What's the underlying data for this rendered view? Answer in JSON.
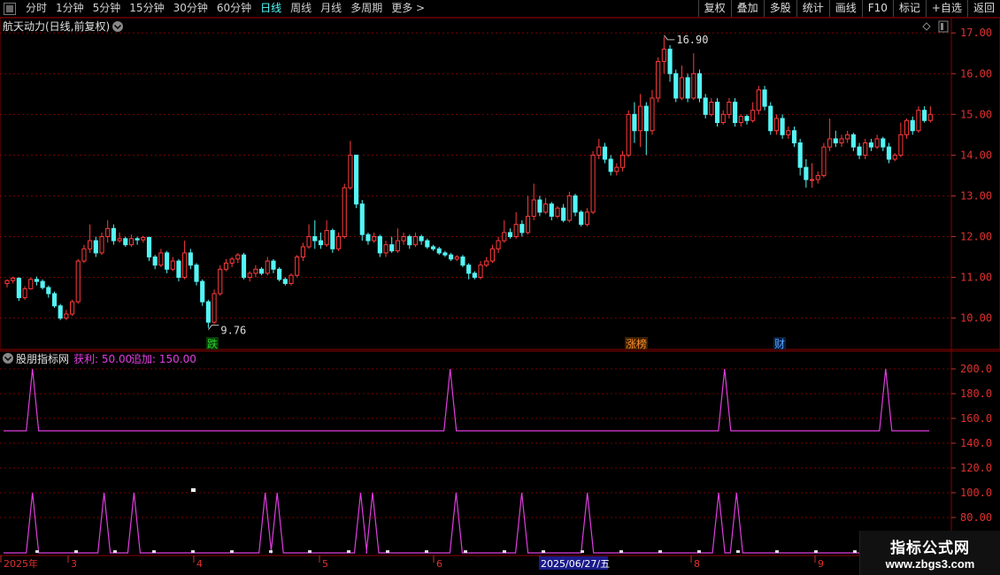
{
  "toolbar": {
    "periods": [
      "分时",
      "1分钟",
      "5分钟",
      "15分钟",
      "30分钟",
      "60分钟",
      "日线",
      "周线",
      "月线",
      "多周期",
      "更多 >"
    ],
    "active_period": "日线",
    "actions": [
      "复权",
      "叠加",
      "多股",
      "统计",
      "画线",
      "F10",
      "标记",
      "+自选",
      "返回"
    ]
  },
  "main_title": "航天动力(日线,前复权)",
  "price_axis": {
    "ticks": [
      "17.00",
      "16.00",
      "15.00",
      "14.00",
      "13.00",
      "12.00",
      "11.00",
      "10.00"
    ]
  },
  "annotations": {
    "high": "16.90",
    "low": "9.76"
  },
  "badges": [
    {
      "text": "跌",
      "color": "#2bd02b"
    },
    {
      "text": "涨榜",
      "color": "#ff8c2a"
    },
    {
      "text": "财",
      "color": "#56a0ff"
    }
  ],
  "indicator": {
    "name": "股朋指标网",
    "value1_label": "获利: 50.00",
    "value2_label": "追加: 150.00",
    "axis_ticks": [
      "200.0",
      "180.0",
      "160.0",
      "140.0",
      "120.0",
      "100.0",
      "80.00"
    ]
  },
  "date_axis": {
    "labels": [
      "2025年",
      "3",
      "4",
      "5",
      "6",
      "2025/06/27/五",
      "8",
      "9"
    ]
  },
  "watermark": {
    "line1": "指标公式网",
    "line2": "www.zbgs3.com"
  },
  "colors": {
    "up": "#ff3b3b",
    "down": "#54f5f5",
    "indicator": "#e03ee0",
    "grid": "#7a0000"
  },
  "chart_data": {
    "type": "candlestick",
    "y_range": [
      9.6,
      17.2
    ],
    "candles": [
      [
        10.85,
        10.92,
        10.75,
        10.95
      ],
      [
        10.92,
        10.98,
        10.85,
        11.02
      ],
      [
        10.98,
        10.5,
        10.42,
        11.0
      ],
      [
        10.5,
        10.72,
        10.45,
        10.78
      ],
      [
        10.72,
        10.95,
        10.7,
        11.0
      ],
      [
        10.95,
        10.9,
        10.8,
        11.02
      ],
      [
        10.9,
        10.75,
        10.7,
        10.95
      ],
      [
        10.75,
        10.6,
        10.5,
        10.8
      ],
      [
        10.6,
        10.3,
        10.25,
        10.65
      ],
      [
        10.3,
        10.0,
        9.95,
        10.35
      ],
      [
        10.0,
        10.1,
        9.95,
        10.2
      ],
      [
        10.1,
        10.4,
        10.05,
        10.45
      ],
      [
        10.4,
        11.4,
        10.35,
        11.45
      ],
      [
        11.4,
        11.7,
        11.35,
        11.8
      ],
      [
        11.7,
        11.9,
        11.6,
        12.3
      ],
      [
        11.9,
        11.6,
        11.5,
        12.0
      ],
      [
        11.6,
        12.0,
        11.55,
        12.1
      ],
      [
        12.0,
        12.2,
        11.85,
        12.4
      ],
      [
        12.2,
        11.9,
        11.8,
        12.3
      ],
      [
        11.9,
        11.95,
        11.85,
        12.1
      ],
      [
        11.95,
        11.8,
        11.75,
        12.0
      ],
      [
        11.8,
        11.95,
        11.75,
        12.05
      ],
      [
        11.95,
        11.92,
        11.8,
        12.0
      ],
      [
        11.92,
        11.98,
        11.85,
        12.02
      ],
      [
        11.98,
        11.5,
        11.4,
        12.0
      ],
      [
        11.5,
        11.3,
        11.2,
        11.55
      ],
      [
        11.3,
        11.6,
        11.25,
        11.7
      ],
      [
        11.6,
        11.2,
        11.1,
        11.65
      ],
      [
        11.2,
        11.4,
        11.15,
        11.5
      ],
      [
        11.4,
        11.0,
        10.9,
        11.45
      ],
      [
        11.0,
        11.6,
        10.95,
        11.9
      ],
      [
        11.6,
        11.3,
        11.2,
        11.7
      ],
      [
        11.3,
        10.9,
        10.8,
        11.35
      ],
      [
        10.9,
        10.4,
        10.3,
        10.95
      ],
      [
        10.4,
        9.9,
        9.76,
        10.45
      ],
      [
        9.9,
        10.6,
        9.85,
        10.7
      ],
      [
        10.6,
        11.2,
        10.55,
        11.3
      ],
      [
        11.2,
        11.35,
        11.15,
        11.45
      ],
      [
        11.35,
        11.45,
        11.25,
        11.5
      ],
      [
        11.45,
        11.55,
        11.35,
        11.6
      ],
      [
        11.55,
        11.0,
        10.95,
        11.6
      ],
      [
        11.0,
        11.1,
        10.9,
        11.15
      ],
      [
        11.1,
        11.2,
        11.0,
        11.3
      ],
      [
        11.2,
        11.1,
        11.05,
        11.25
      ],
      [
        11.1,
        11.4,
        11.05,
        11.5
      ],
      [
        11.4,
        11.2,
        11.1,
        11.45
      ],
      [
        11.2,
        10.95,
        10.9,
        11.25
      ],
      [
        10.95,
        10.85,
        10.8,
        11.0
      ],
      [
        10.85,
        11.05,
        10.8,
        11.1
      ],
      [
        11.05,
        11.5,
        11.0,
        11.55
      ],
      [
        11.5,
        11.75,
        11.4,
        11.85
      ],
      [
        11.75,
        12.0,
        11.7,
        12.3
      ],
      [
        12.0,
        11.9,
        11.7,
        12.4
      ],
      [
        11.9,
        11.8,
        11.7,
        12.1
      ],
      [
        11.8,
        12.15,
        11.75,
        12.4
      ],
      [
        12.15,
        11.7,
        11.6,
        12.2
      ],
      [
        11.7,
        12.0,
        11.65,
        12.1
      ],
      [
        12.0,
        13.2,
        11.95,
        13.3
      ],
      [
        13.2,
        14.0,
        13.15,
        14.35
      ],
      [
        14.0,
        12.8,
        12.7,
        14.0
      ],
      [
        12.8,
        12.05,
        11.9,
        12.9
      ],
      [
        12.05,
        11.9,
        11.8,
        12.1
      ],
      [
        11.9,
        12.0,
        11.85,
        12.1
      ],
      [
        12.0,
        11.6,
        11.5,
        12.05
      ],
      [
        11.6,
        11.8,
        11.5,
        11.9
      ],
      [
        11.8,
        11.65,
        11.6,
        12.0
      ],
      [
        11.65,
        11.9,
        11.6,
        12.2
      ],
      [
        11.9,
        12.0,
        11.8,
        12.1
      ],
      [
        12.0,
        11.8,
        11.7,
        12.05
      ],
      [
        11.8,
        12.0,
        11.75,
        12.1
      ],
      [
        12.0,
        11.9,
        11.8,
        12.05
      ],
      [
        11.9,
        11.75,
        11.7,
        11.95
      ],
      [
        11.75,
        11.7,
        11.65,
        11.8
      ],
      [
        11.7,
        11.6,
        11.55,
        11.75
      ],
      [
        11.6,
        11.55,
        11.5,
        11.65
      ],
      [
        11.55,
        11.45,
        11.4,
        11.6
      ],
      [
        11.45,
        11.5,
        11.4,
        11.55
      ],
      [
        11.5,
        11.3,
        11.25,
        11.55
      ],
      [
        11.3,
        11.1,
        10.95,
        11.35
      ],
      [
        11.1,
        11.0,
        10.95,
        11.15
      ],
      [
        11.0,
        11.3,
        10.95,
        11.4
      ],
      [
        11.3,
        11.4,
        11.25,
        11.5
      ],
      [
        11.4,
        11.7,
        11.35,
        11.8
      ],
      [
        11.7,
        11.9,
        11.6,
        12.0
      ],
      [
        11.9,
        12.1,
        11.85,
        12.4
      ],
      [
        12.1,
        12.0,
        11.95,
        12.2
      ],
      [
        12.0,
        12.3,
        11.95,
        12.6
      ],
      [
        12.3,
        12.1,
        12.0,
        12.4
      ],
      [
        12.1,
        12.5,
        12.05,
        13.0
      ],
      [
        12.5,
        12.9,
        12.4,
        13.3
      ],
      [
        12.9,
        12.6,
        12.5,
        13.0
      ],
      [
        12.6,
        12.8,
        12.55,
        12.95
      ],
      [
        12.8,
        12.5,
        12.4,
        12.85
      ],
      [
        12.5,
        12.7,
        12.45,
        12.75
      ],
      [
        12.7,
        12.4,
        12.35,
        12.8
      ],
      [
        12.4,
        13.0,
        12.35,
        13.1
      ],
      [
        13.0,
        12.6,
        12.5,
        13.05
      ],
      [
        12.6,
        12.3,
        12.25,
        12.65
      ],
      [
        12.3,
        12.6,
        12.25,
        12.7
      ],
      [
        12.6,
        14.0,
        12.55,
        14.1
      ],
      [
        14.0,
        14.2,
        13.9,
        14.4
      ],
      [
        14.2,
        13.9,
        13.8,
        14.3
      ],
      [
        13.9,
        13.6,
        13.5,
        14.0
      ],
      [
        13.6,
        13.7,
        13.5,
        13.8
      ],
      [
        13.7,
        14.0,
        13.6,
        14.1
      ],
      [
        14.0,
        15.0,
        13.95,
        15.1
      ],
      [
        15.0,
        14.6,
        14.3,
        15.3
      ],
      [
        14.6,
        15.2,
        14.2,
        15.5
      ],
      [
        15.2,
        14.6,
        14.0,
        15.3
      ],
      [
        14.6,
        15.4,
        14.5,
        15.6
      ],
      [
        15.4,
        16.3,
        15.3,
        16.4
      ],
      [
        16.3,
        16.6,
        16.0,
        16.9
      ],
      [
        16.6,
        16.0,
        15.8,
        16.7
      ],
      [
        16.0,
        15.4,
        15.3,
        16.1
      ],
      [
        15.4,
        15.9,
        15.35,
        16.2
      ],
      [
        15.9,
        15.4,
        15.3,
        16.0
      ],
      [
        15.4,
        16.0,
        15.35,
        16.5
      ],
      [
        16.0,
        15.4,
        15.3,
        16.1
      ],
      [
        15.4,
        15.0,
        14.9,
        15.5
      ],
      [
        15.0,
        15.3,
        14.95,
        15.4
      ],
      [
        15.3,
        14.8,
        14.7,
        15.4
      ],
      [
        14.8,
        15.0,
        14.75,
        15.1
      ],
      [
        15.0,
        15.3,
        14.9,
        15.4
      ],
      [
        15.3,
        14.8,
        14.7,
        15.4
      ],
      [
        14.8,
        14.95,
        14.7,
        15.0
      ],
      [
        14.95,
        14.85,
        14.75,
        15.0
      ],
      [
        14.85,
        15.1,
        14.8,
        15.3
      ],
      [
        15.1,
        15.6,
        15.0,
        15.7
      ],
      [
        15.6,
        15.2,
        15.1,
        15.7
      ],
      [
        15.2,
        14.6,
        14.5,
        15.3
      ],
      [
        14.6,
        14.9,
        14.5,
        15.0
      ],
      [
        14.9,
        14.5,
        14.4,
        15.0
      ],
      [
        14.5,
        14.6,
        14.4,
        14.7
      ],
      [
        14.6,
        14.3,
        14.2,
        14.7
      ],
      [
        14.3,
        13.7,
        13.5,
        14.4
      ],
      [
        13.7,
        13.4,
        13.2,
        13.9
      ],
      [
        13.4,
        13.4,
        13.2,
        13.8
      ],
      [
        13.4,
        13.5,
        13.3,
        13.6
      ],
      [
        13.5,
        14.2,
        13.45,
        14.3
      ],
      [
        14.2,
        14.4,
        14.1,
        14.9
      ],
      [
        14.4,
        14.3,
        14.2,
        14.6
      ],
      [
        14.3,
        14.4,
        14.2,
        14.5
      ],
      [
        14.4,
        14.5,
        14.3,
        14.6
      ],
      [
        14.5,
        14.2,
        14.1,
        14.55
      ],
      [
        14.2,
        14.0,
        13.9,
        14.3
      ],
      [
        14.0,
        14.3,
        13.9,
        14.4
      ],
      [
        14.3,
        14.2,
        14.1,
        14.4
      ],
      [
        14.2,
        14.4,
        14.15,
        14.5
      ],
      [
        14.4,
        14.2,
        14.1,
        14.45
      ],
      [
        14.2,
        13.9,
        13.8,
        14.3
      ],
      [
        13.9,
        14.0,
        13.85,
        14.05
      ],
      [
        14.0,
        14.5,
        13.95,
        14.8
      ],
      [
        14.5,
        14.85,
        14.4,
        14.9
      ],
      [
        14.85,
        14.6,
        14.5,
        14.95
      ],
      [
        14.6,
        15.1,
        14.55,
        15.2
      ],
      [
        15.1,
        14.85,
        14.8,
        15.2
      ],
      [
        14.85,
        15.0,
        14.8,
        15.2
      ]
    ],
    "indicator_series": [
      {
        "name": "获利",
        "spike_indices": [
          1,
          71,
          117,
          144
        ],
        "base": 150,
        "peak": 200
      },
      {
        "name": "追加",
        "spike_indices": [
          1,
          13,
          18,
          40,
          42,
          56,
          58,
          72,
          83,
          94,
          116,
          119
        ],
        "base": 70,
        "peak": 100
      }
    ]
  }
}
